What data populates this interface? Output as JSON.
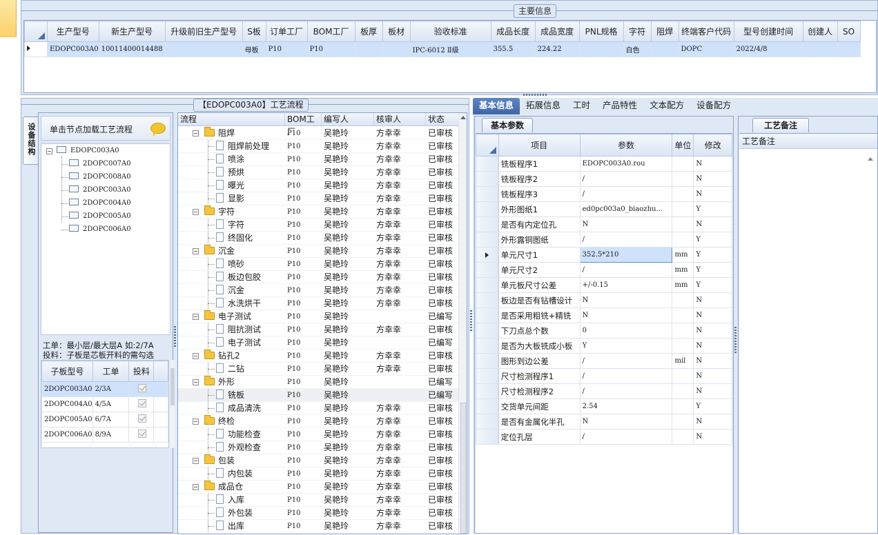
{
  "main_info": {
    "title": "主要信息",
    "columns": [
      "生产型号",
      "新生产型号",
      "升级前旧生产型号",
      "S板",
      "订单工厂",
      "BOM工厂",
      "板厚",
      "板材",
      "验收标准",
      "成品长度",
      "成品宽度",
      "PNL规格",
      "字符",
      "阻焊",
      "终端客户代码",
      "型号创建时间",
      "创建人",
      "SO"
    ],
    "row": [
      "EDOPC003A0",
      "10011400014488",
      "",
      "母板",
      "P10",
      "P10",
      "",
      "",
      "IPC-6012 Ⅱ级",
      "355.5",
      "224.22",
      "",
      "白色",
      "",
      "DOPC",
      "2022/4/8",
      "",
      ""
    ]
  },
  "device_panel": {
    "vertical_tab": "设备结构",
    "load_hint": "单击节点加载工艺流程",
    "tree_root": "EDOPC003A0",
    "tree_children": [
      "2DOPC007A0",
      "2DOPC008A0",
      "2DOPC003A0",
      "2DOPC004A0",
      "2DOPC005A0",
      "2DOPC006A0"
    ],
    "note1": "工单：最小层/最大层A 如:2/7A",
    "note2": "投料：子板是芯板开料的需勾选",
    "sub_columns": [
      "子板型号",
      "工单",
      "投料"
    ],
    "sub_rows": [
      {
        "model": "2DOPC003A0",
        "order": "2/3A"
      },
      {
        "model": "2DOPC004A0",
        "order": "4/5A"
      },
      {
        "model": "2DOPC005A0",
        "order": "6/7A"
      },
      {
        "model": "2DOPC006A0",
        "order": "8/9A"
      }
    ]
  },
  "flow": {
    "title": "【EDOPC003A0】工艺流程",
    "columns": [
      "流程",
      "BOM工厂",
      "编写人",
      "核审人",
      "状态"
    ],
    "rows": [
      {
        "level": 0,
        "name": "阻焊",
        "bom": "P10",
        "writer": "吴艳玲",
        "auditor": "方幸幸",
        "status": "已审核"
      },
      {
        "level": 1,
        "name": "阻焊前处理",
        "bom": "P10",
        "writer": "吴艳玲",
        "auditor": "方幸幸",
        "status": "已审核"
      },
      {
        "level": 1,
        "name": "喷涂",
        "bom": "P10",
        "writer": "吴艳玲",
        "auditor": "方幸幸",
        "status": "已审核"
      },
      {
        "level": 1,
        "name": "预烘",
        "bom": "P10",
        "writer": "吴艳玲",
        "auditor": "方幸幸",
        "status": "已审核"
      },
      {
        "level": 1,
        "name": "曝光",
        "bom": "P10",
        "writer": "吴艳玲",
        "auditor": "方幸幸",
        "status": "已审核"
      },
      {
        "level": 1,
        "name": "显影",
        "bom": "P10",
        "writer": "吴艳玲",
        "auditor": "方幸幸",
        "status": "已审核"
      },
      {
        "level": 0,
        "name": "字符",
        "bom": "P10",
        "writer": "吴艳玲",
        "auditor": "方幸幸",
        "status": "已审核"
      },
      {
        "level": 1,
        "name": "字符",
        "bom": "P10",
        "writer": "吴艳玲",
        "auditor": "方幸幸",
        "status": "已审核"
      },
      {
        "level": 1,
        "name": "终固化",
        "bom": "P10",
        "writer": "吴艳玲",
        "auditor": "方幸幸",
        "status": "已审核"
      },
      {
        "level": 0,
        "name": "沉金",
        "bom": "P10",
        "writer": "吴艳玲",
        "auditor": "方幸幸",
        "status": "已审核"
      },
      {
        "level": 1,
        "name": "喷砂",
        "bom": "P10",
        "writer": "吴艳玲",
        "auditor": "方幸幸",
        "status": "已审核"
      },
      {
        "level": 1,
        "name": "板边包胶",
        "bom": "P10",
        "writer": "吴艳玲",
        "auditor": "方幸幸",
        "status": "已审核"
      },
      {
        "level": 1,
        "name": "沉金",
        "bom": "P10",
        "writer": "吴艳玲",
        "auditor": "方幸幸",
        "status": "已审核"
      },
      {
        "level": 1,
        "name": "水洗烘干",
        "bom": "P10",
        "writer": "吴艳玲",
        "auditor": "方幸幸",
        "status": "已审核"
      },
      {
        "level": 0,
        "name": "电子测试",
        "bom": "P10",
        "writer": "吴艳玲",
        "auditor": "",
        "status": "已编写"
      },
      {
        "level": 1,
        "name": "阻抗测试",
        "bom": "P10",
        "writer": "吴艳玲",
        "auditor": "方幸幸",
        "status": "已审核"
      },
      {
        "level": 1,
        "name": "电子测试",
        "bom": "P10",
        "writer": "吴艳玲",
        "auditor": "",
        "status": "已编写"
      },
      {
        "level": 0,
        "name": "钻孔2",
        "bom": "P10",
        "writer": "吴艳玲",
        "auditor": "方幸幸",
        "status": "已审核"
      },
      {
        "level": 1,
        "name": "二钻",
        "bom": "P10",
        "writer": "吴艳玲",
        "auditor": "方幸幸",
        "status": "已审核"
      },
      {
        "level": 0,
        "name": "外形",
        "bom": "P10",
        "writer": "吴艳玲",
        "auditor": "",
        "status": "已编写"
      },
      {
        "level": 1,
        "name": "铣板",
        "bom": "P10",
        "writer": "吴艳玲",
        "auditor": "",
        "status": "已编写",
        "active": true
      },
      {
        "level": 1,
        "name": "成品清洗",
        "bom": "P10",
        "writer": "吴艳玲",
        "auditor": "方幸幸",
        "status": "已审核"
      },
      {
        "level": 0,
        "name": "终检",
        "bom": "P10",
        "writer": "吴艳玲",
        "auditor": "方幸幸",
        "status": "已审核"
      },
      {
        "level": 1,
        "name": "功能检查",
        "bom": "P10",
        "writer": "吴艳玲",
        "auditor": "方幸幸",
        "status": "已审核"
      },
      {
        "level": 1,
        "name": "外观检查",
        "bom": "P10",
        "writer": "吴艳玲",
        "auditor": "方幸幸",
        "status": "已审核"
      },
      {
        "level": 0,
        "name": "包装",
        "bom": "P10",
        "writer": "吴艳玲",
        "auditor": "方幸幸",
        "status": "已审核"
      },
      {
        "level": 1,
        "name": "内包装",
        "bom": "P10",
        "writer": "吴艳玲",
        "auditor": "方幸幸",
        "status": "已审核"
      },
      {
        "level": 0,
        "name": "成品仓",
        "bom": "P10",
        "writer": "吴艳玲",
        "auditor": "方幸幸",
        "status": "已审核"
      },
      {
        "level": 1,
        "name": "入库",
        "bom": "P10",
        "writer": "吴艳玲",
        "auditor": "方幸幸",
        "status": "已审核"
      },
      {
        "level": 1,
        "name": "外包装",
        "bom": "P10",
        "writer": "吴艳玲",
        "auditor": "方幸幸",
        "status": "已审核"
      },
      {
        "level": 1,
        "name": "出库",
        "bom": "P10",
        "writer": "吴艳玲",
        "auditor": "方幸幸",
        "status": "已审核"
      }
    ]
  },
  "right": {
    "tabs": [
      "基本信息",
      "拓展信息",
      "工时",
      "产品特性",
      "文本配方",
      "设备配方"
    ],
    "basic_tab": "基本参数",
    "param_columns": [
      "项目",
      "参数",
      "单位",
      "修改"
    ],
    "params": [
      {
        "item": "铣板程序1",
        "value": "EDOPC003A0.rou",
        "unit": "",
        "mod": "N"
      },
      {
        "item": "铣板程序2",
        "value": "/",
        "unit": "",
        "mod": "N"
      },
      {
        "item": "铣板程序3",
        "value": "/",
        "unit": "",
        "mod": "N"
      },
      {
        "item": "外形图纸1",
        "value": "ed0pc003a0_biaozhu...",
        "unit": "",
        "mod": "Y"
      },
      {
        "item": "是否有内定位孔",
        "value": "N",
        "unit": "",
        "mod": "N"
      },
      {
        "item": "外形露铜图纸",
        "value": "/",
        "unit": "",
        "mod": "Y"
      },
      {
        "item": "单元尺寸1",
        "value": "352.5*210",
        "unit": "mm",
        "mod": "Y",
        "selected": true
      },
      {
        "item": "单元尺寸2",
        "value": "/",
        "unit": "mm",
        "mod": "Y"
      },
      {
        "item": "单元板尺寸公差",
        "value": "+/-0.15",
        "unit": "mm",
        "mod": "Y"
      },
      {
        "item": "板边是否有钻槽设计",
        "value": "N",
        "unit": "",
        "mod": "N"
      },
      {
        "item": "是否采用粗铣+精铣",
        "value": "N",
        "unit": "",
        "mod": "N"
      },
      {
        "item": "下刀点总个数",
        "value": "0",
        "unit": "",
        "mod": "N"
      },
      {
        "item": "是否为大板铣成小板",
        "value": "Y",
        "unit": "",
        "mod": "N"
      },
      {
        "item": "图形到边公差",
        "value": "/",
        "unit": "mil",
        "mod": "N"
      },
      {
        "item": "尺寸检测程序1",
        "value": "/",
        "unit": "",
        "mod": "N"
      },
      {
        "item": "尺寸检测程序2",
        "value": "/",
        "unit": "",
        "mod": "N"
      },
      {
        "item": "交货单元间距",
        "value": "2.54",
        "unit": "",
        "mod": "Y"
      },
      {
        "item": "是否有金属化半孔",
        "value": "N",
        "unit": "",
        "mod": "N"
      },
      {
        "item": "定位孔层",
        "value": "/",
        "unit": "",
        "mod": "N"
      }
    ],
    "remark_tab": "工艺备注",
    "remark_header": "工艺备注"
  }
}
